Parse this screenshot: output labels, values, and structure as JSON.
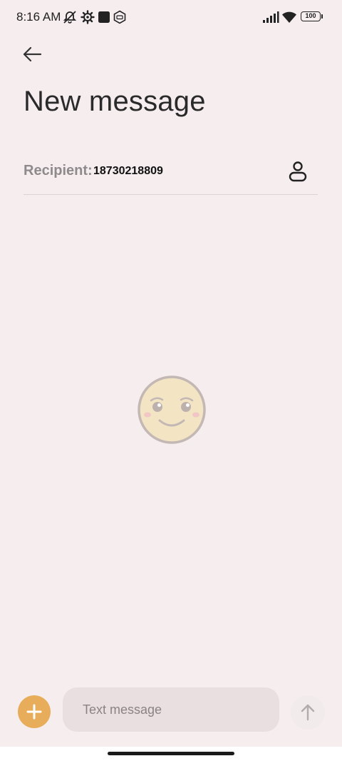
{
  "status_bar": {
    "time": "8:16 AM",
    "battery": "100",
    "icons": [
      "alarm-off-icon",
      "settings-gear-icon",
      "square-icon",
      "shield-hex-icon",
      "signal-icon",
      "wifi-icon",
      "battery-icon"
    ]
  },
  "header": {
    "back_icon": "arrow-left-icon",
    "title": "New message"
  },
  "recipient": {
    "label": "Recipient:",
    "value": "18730218809",
    "contact_icon": "person-icon"
  },
  "empty_state": {
    "illustration": "smiley-face-icon"
  },
  "composer": {
    "add_icon": "plus-icon",
    "placeholder": "Text message",
    "send_icon": "arrow-up-icon"
  },
  "colors": {
    "background": "#f6edee",
    "accent": "#e8ad5b",
    "input_background": "#e9dfe0"
  }
}
